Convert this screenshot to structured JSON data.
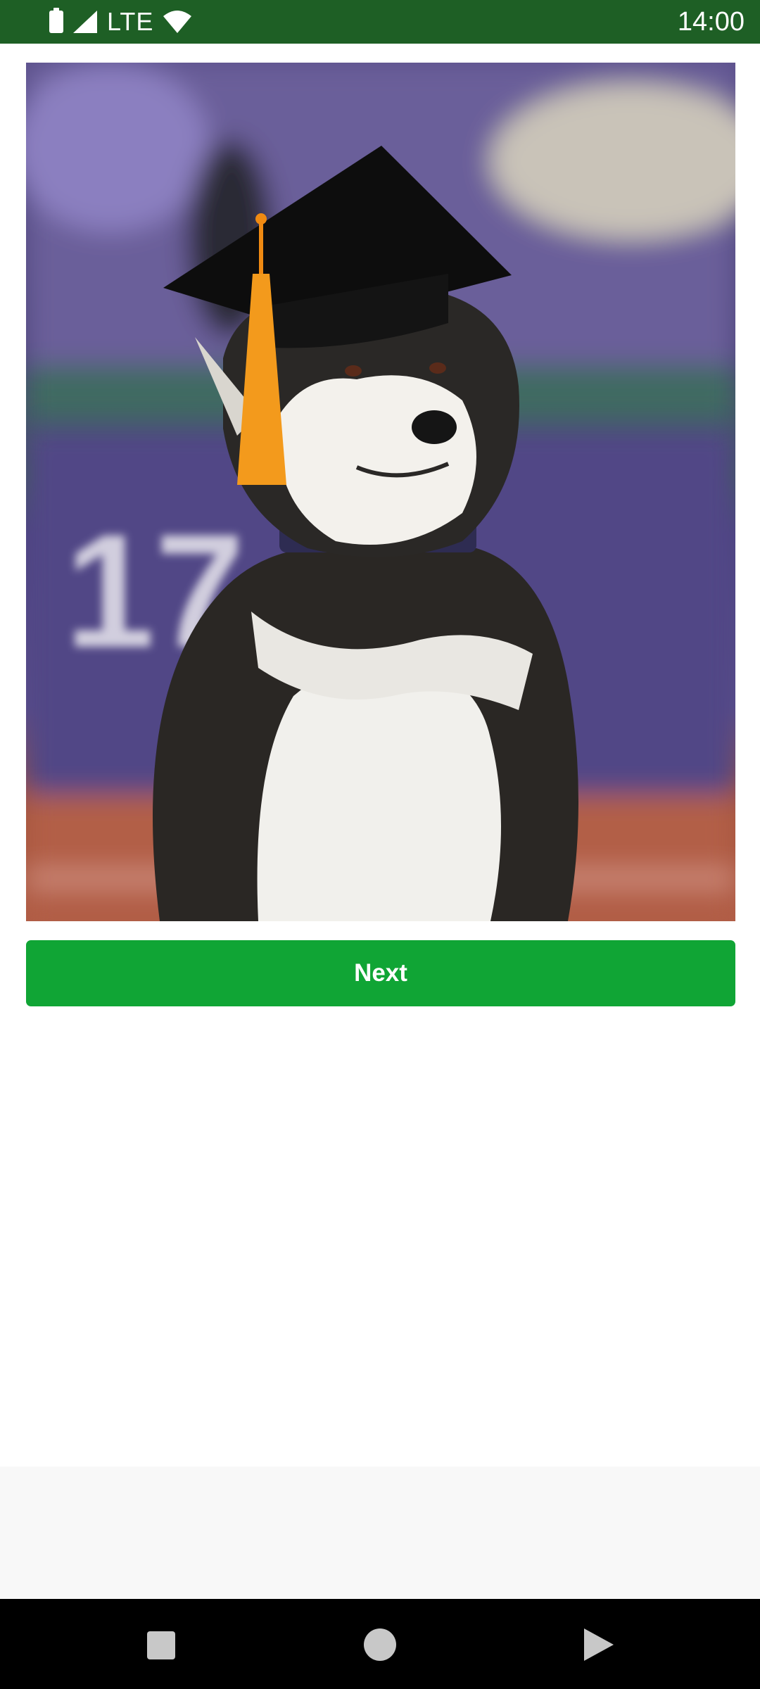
{
  "status_bar": {
    "network": "LTE",
    "time": "14:00"
  },
  "main": {
    "next_label": "Next"
  },
  "colors": {
    "status_bar_bg": "#1e5f25",
    "button_bg": "#10a535",
    "nav_bar_bg": "#000000"
  },
  "icons": {
    "battery": "battery-icon",
    "signal": "signal-icon",
    "wifi": "wifi-icon",
    "recent": "recent-apps-icon",
    "home": "home-icon",
    "back": "back-icon"
  }
}
